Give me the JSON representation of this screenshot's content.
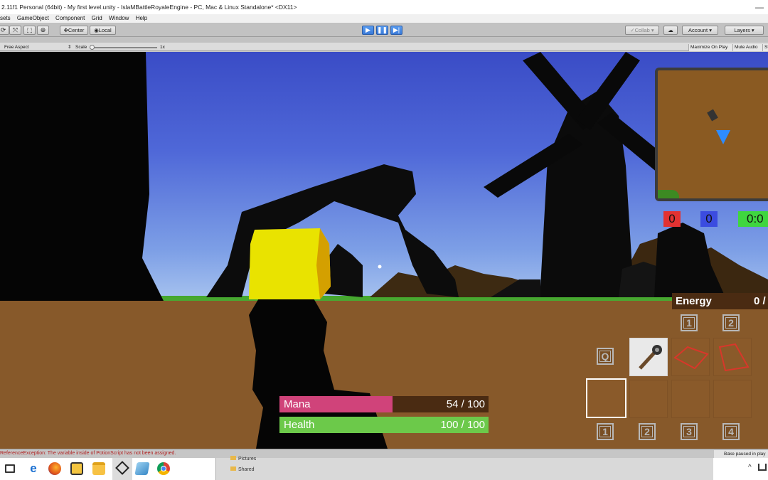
{
  "window": {
    "title": "2.11f1 Personal (64bit) - My first level.unity - IslaMBattleRoyaleEngine - PC, Mac & Linux Standalone* <DX11>",
    "close_glyph": "—"
  },
  "menu": [
    "sets",
    "GameObject",
    "Component",
    "Grid",
    "Window",
    "Help"
  ],
  "toolbar": {
    "pivot_label": "Center",
    "space_label": "Local",
    "collab_label": "Collab",
    "account_label": "Account",
    "layers_label": "Layers",
    "play_icon": "play-icon",
    "pause_icon": "pause-icon",
    "step_icon": "step-icon"
  },
  "game_view": {
    "aspect_label": "Free Aspect",
    "scale_label": "Scale",
    "scale_value": "1x",
    "maximize_label": "Maximize On Play",
    "mute_label": "Mute Audio",
    "stats_label": "St"
  },
  "hud": {
    "mana": {
      "label": "Mana",
      "value_text": "54 / 100",
      "fraction": 0.54,
      "color": "#d0437a",
      "bg": "#4a2b12"
    },
    "health": {
      "label": "Health",
      "value_text": "100 / 100",
      "fraction": 1.0,
      "color": "#6cc94a",
      "bg": "#4a2b12"
    },
    "energy": {
      "label": "Energy",
      "value_text": "0 /"
    },
    "scores": [
      {
        "value": "0",
        "color": "#e23232"
      },
      {
        "value": "0",
        "color": "#3b4ce0"
      },
      {
        "value": "0:0",
        "color": "#3fd63f"
      }
    ],
    "skill_keys_top": [
      "1",
      "2"
    ],
    "ability_key": "Q",
    "hotbar_keys": [
      "1",
      "2",
      "3",
      "4"
    ],
    "equipped_item": "staff-icon"
  },
  "console": {
    "error_text": "ReferenceException: The variable inside of PotionScript has not been assigned.",
    "bake_text": "Bake paused in play"
  },
  "explorer": {
    "items": [
      "Pictures",
      "Shared"
    ]
  },
  "taskbar": {
    "icons": [
      "task-view-icon",
      "edge-icon",
      "firefox-icon",
      "media-icon",
      "file-explorer-icon",
      "unity-icon",
      "app-icon",
      "chrome-icon"
    ]
  }
}
